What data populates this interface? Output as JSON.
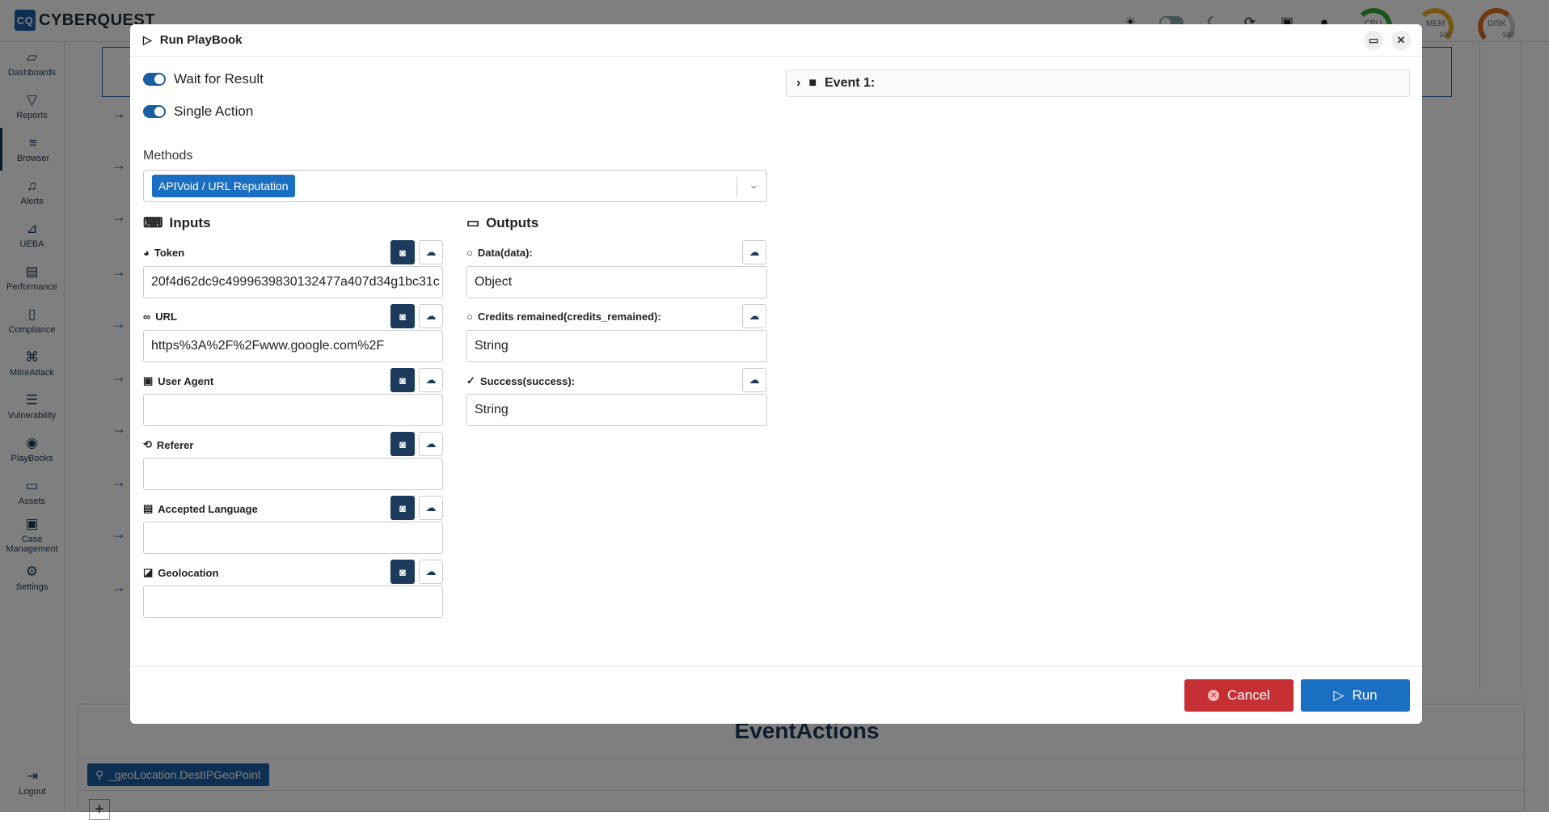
{
  "app": {
    "brand": "CYBERQUEST",
    "brand_mark": "CQ"
  },
  "topbar": {
    "gauges": [
      {
        "label": "CPU",
        "min": "",
        "max": ""
      },
      {
        "label": "MEM",
        "min": "",
        "max": "100"
      },
      {
        "label": "DISK",
        "min": "0",
        "max": "100"
      }
    ]
  },
  "sidebar": {
    "items": [
      {
        "label": "Dashboards"
      },
      {
        "label": "Reports"
      },
      {
        "label": "Browser"
      },
      {
        "label": "Alerts"
      },
      {
        "label": "UEBA"
      },
      {
        "label": "Performance"
      },
      {
        "label": "Compliance"
      },
      {
        "label": "MitreAttack"
      },
      {
        "label": "Vulnerability"
      },
      {
        "label": "PlayBooks"
      },
      {
        "label": "Assets"
      },
      {
        "label": "Case Management"
      },
      {
        "label": "Settings"
      }
    ],
    "logout": "Logout"
  },
  "background": {
    "section_title": "EventActions",
    "tag": "_geoLocation.DestIPGeoPoint",
    "plus": "+"
  },
  "modal": {
    "title": "Run PlayBook",
    "wait_for_result": "Wait for Result",
    "single_action": "Single Action",
    "methods_label": "Methods",
    "method_tag": "APIVoid / URL Reputation",
    "inputs_title": "Inputs",
    "outputs_title": "Outputs",
    "inputs": [
      {
        "label": "Token",
        "value": "20f4d62dc9c4999639830132477a407d34g1bc31c"
      },
      {
        "label": "URL",
        "value": "https%3A%2F%2Fwww.google.com%2F"
      },
      {
        "label": "User Agent",
        "value": ""
      },
      {
        "label": "Referer",
        "value": ""
      },
      {
        "label": "Accepted Language",
        "value": ""
      },
      {
        "label": "Geolocation",
        "value": ""
      }
    ],
    "outputs": [
      {
        "label": "Data(data):",
        "value": "Object"
      },
      {
        "label": "Credits remained(credits_remained):",
        "value": "String"
      },
      {
        "label": "Success(success):",
        "value": "String"
      }
    ],
    "event_label": "Event 1:",
    "cancel": "Cancel",
    "run": "Run"
  }
}
